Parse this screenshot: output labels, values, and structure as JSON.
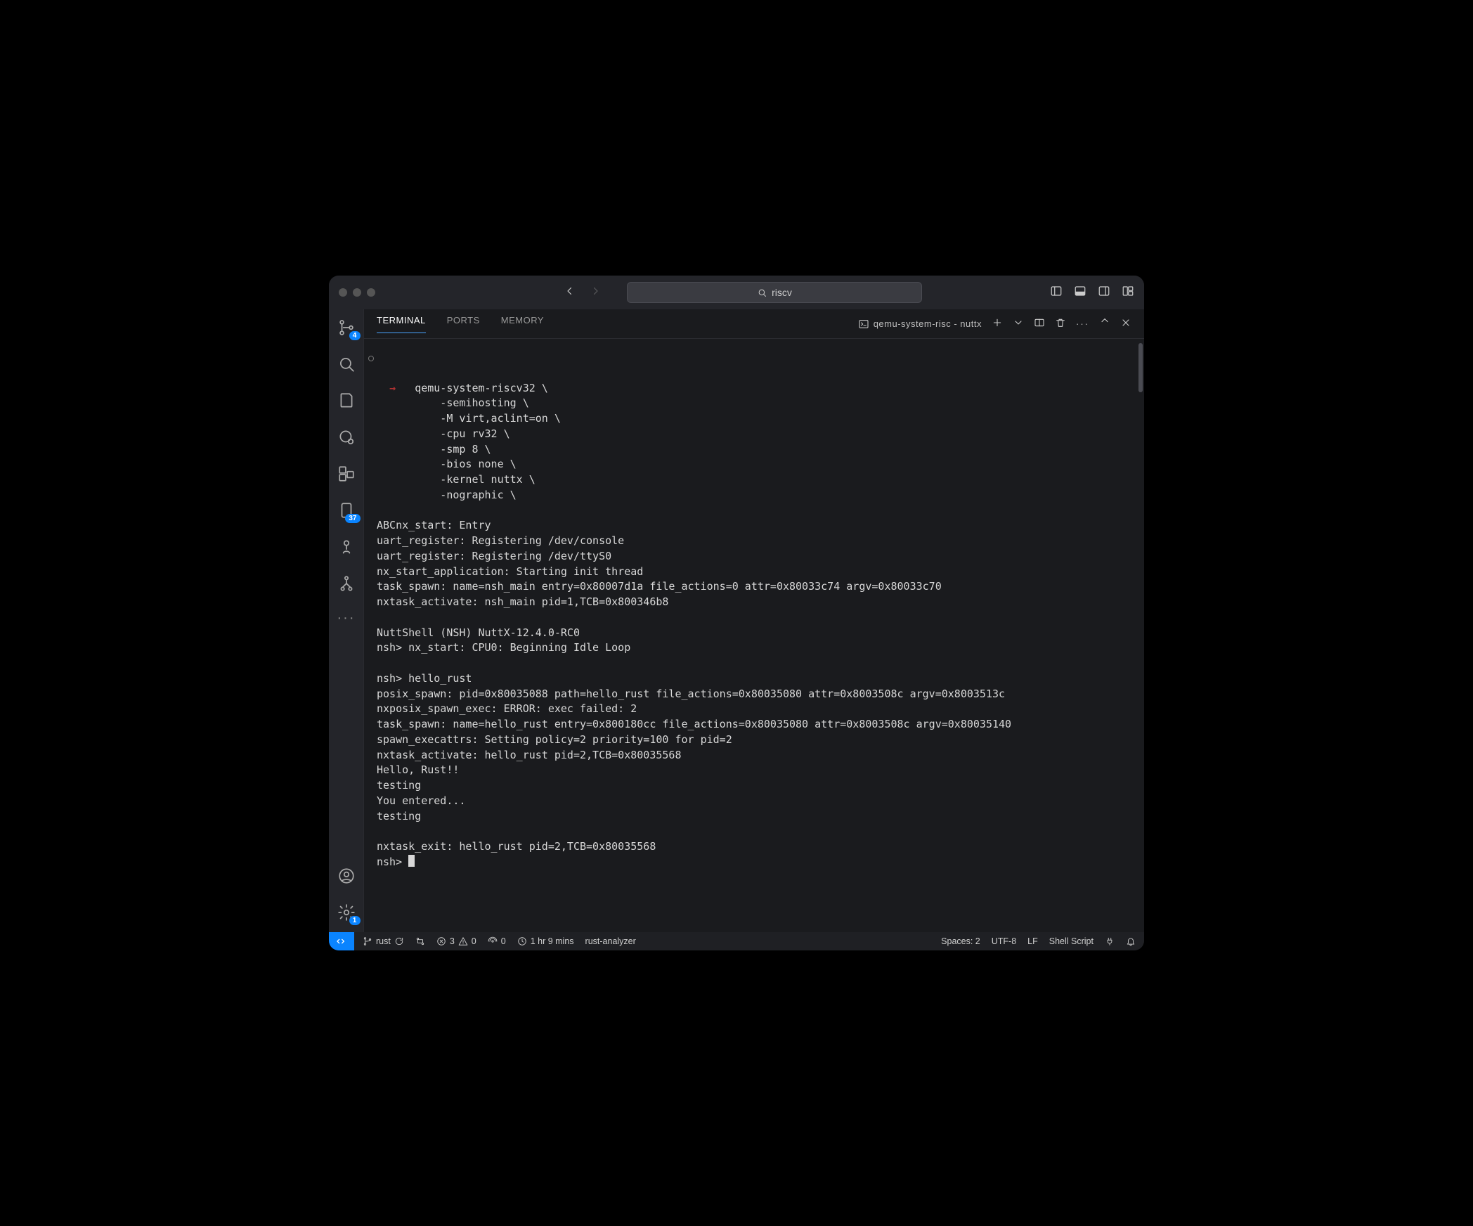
{
  "titlebar": {
    "search_text": "riscv"
  },
  "activitybar": {
    "scm_badge": "4",
    "folder_badge": "37",
    "settings_badge": "1"
  },
  "panel": {
    "tabs": {
      "terminal": "TERMINAL",
      "ports": "PORTS",
      "memory": "MEMORY"
    },
    "terminal_name": "qemu-system-risc - nuttx"
  },
  "terminal": {
    "cmd_indent": "   ",
    "cmd_line1": "qemu-system-riscv32 \\",
    "cmd_line2": "    -semihosting \\",
    "cmd_line3": "    -M virt,aclint=on \\",
    "cmd_line4": "    -cpu rv32 \\",
    "cmd_line5": "    -smp 8 \\",
    "cmd_line6": "    -bios none \\",
    "cmd_line7": "    -kernel nuttx \\",
    "cmd_line8": "    -nographic \\",
    "blank": "",
    "l01": "ABCnx_start: Entry",
    "l02": "uart_register: Registering /dev/console",
    "l03": "uart_register: Registering /dev/ttyS0",
    "l04": "nx_start_application: Starting init thread",
    "l05": "task_spawn: name=nsh_main entry=0x80007d1a file_actions=0 attr=0x80033c74 argv=0x80033c70",
    "l06": "nxtask_activate: nsh_main pid=1,TCB=0x800346b8",
    "l07": "NuttShell (NSH) NuttX-12.4.0-RC0",
    "l08": "nsh> nx_start: CPU0: Beginning Idle Loop",
    "l09": "nsh> hello_rust",
    "l10": "posix_spawn: pid=0x80035088 path=hello_rust file_actions=0x80035080 attr=0x8003508c argv=0x8003513c",
    "l11": "nxposix_spawn_exec: ERROR: exec failed: 2",
    "l12": "task_spawn: name=hello_rust entry=0x800180cc file_actions=0x80035080 attr=0x8003508c argv=0x80035140",
    "l13": "spawn_execattrs: Setting policy=2 priority=100 for pid=2",
    "l14": "nxtask_activate: hello_rust pid=2,TCB=0x80035568",
    "l15": "Hello, Rust!!",
    "l16": "testing",
    "l17": "You entered...",
    "l18": "testing",
    "l19": "nxtask_exit: hello_rust pid=2,TCB=0x80035568",
    "l20": "nsh> "
  },
  "statusbar": {
    "branch": "rust",
    "errors": "3",
    "warnings": "0",
    "radio": "0",
    "time": "1 hr 9 mins",
    "lsp": "rust-analyzer",
    "spaces": "Spaces: 2",
    "encoding": "UTF-8",
    "eol": "LF",
    "lang": "Shell Script"
  }
}
